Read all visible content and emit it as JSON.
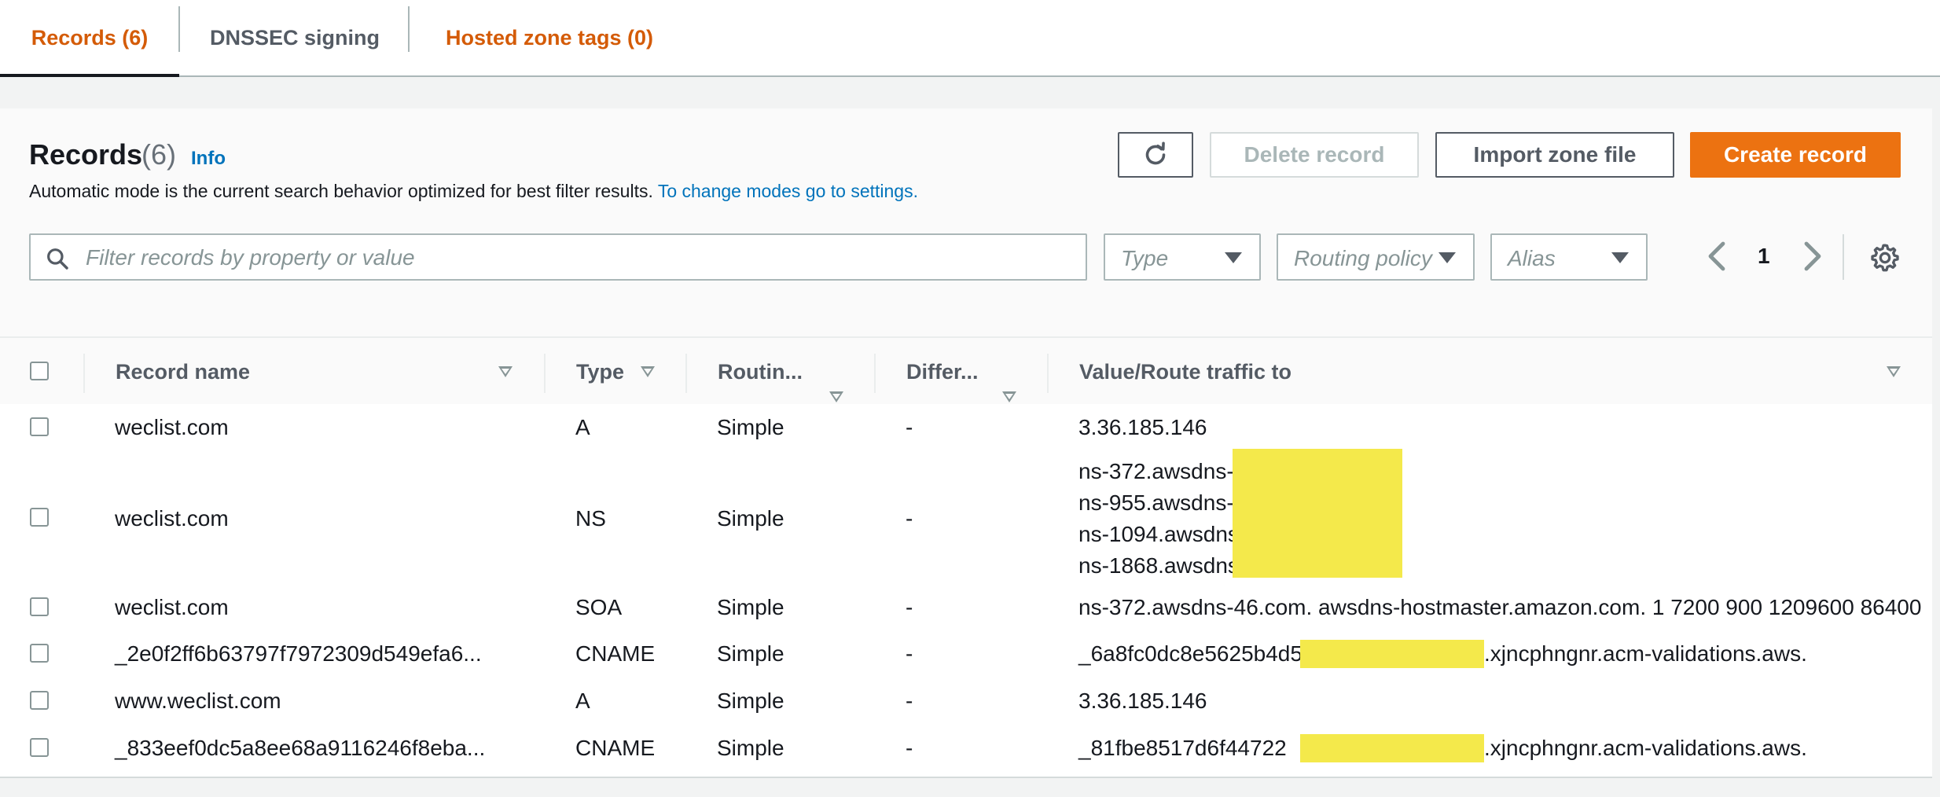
{
  "tabs": [
    {
      "label": "Records (6)",
      "active": true
    },
    {
      "label": "DNSSEC signing",
      "active": false
    },
    {
      "label": "Hosted zone tags (0)",
      "active": false
    }
  ],
  "header": {
    "title": "Records",
    "count": "(6)",
    "info": "Info",
    "description": "Automatic mode is the current search behavior optimized for best filter results. ",
    "description_link": "To change modes go to settings."
  },
  "actions": {
    "refresh": "refresh-icon",
    "delete": "Delete record",
    "import": "Import zone file",
    "create": "Create record"
  },
  "filters": {
    "search_placeholder": "Filter records by property or value",
    "search_value": "",
    "type": "Type",
    "routing_policy": "Routing policy",
    "alias": "Alias"
  },
  "pagination": {
    "current_page": "1"
  },
  "columns": [
    "Record name",
    "Type",
    "Routin...",
    "Differ...",
    "Value/Route traffic to"
  ],
  "rows": [
    {
      "name": "weclist.com",
      "type": "A",
      "routing": "Simple",
      "differ": "-",
      "values": [
        "3.36.185.146"
      ]
    },
    {
      "name": "weclist.com",
      "type": "NS",
      "routing": "Simple",
      "differ": "-",
      "values": [
        "ns-372.awsdns-",
        "ns-955.awsdns-",
        "ns-1094.awsdns",
        "ns-1868.awsdns"
      ]
    },
    {
      "name": "weclist.com",
      "type": "SOA",
      "routing": "Simple",
      "differ": "-",
      "values": [
        "ns-372.awsdns-46.com. awsdns-hostmaster.amazon.com. 1 7200 900 1209600 86400"
      ]
    },
    {
      "name": "_2e0f2ff6b63797f7972309d549efa6...",
      "type": "CNAME",
      "routing": "Simple",
      "differ": "-",
      "values": [
        "_6a8fc0dc8e5625b4d5"
      ],
      "suffix": ".xjncphngnr.acm-validations.aws."
    },
    {
      "name": "www.weclist.com",
      "type": "A",
      "routing": "Simple",
      "differ": "-",
      "values": [
        "3.36.185.146"
      ]
    },
    {
      "name": "_833eef0dc5a8ee68a9116246f8eba...",
      "type": "CNAME",
      "routing": "Simple",
      "differ": "-",
      "values": [
        "_81fbe8517d6f44722"
      ],
      "suffix": ".xjncphngnr.acm-validations.aws."
    }
  ],
  "colors": {
    "accent": "#ec7211",
    "tab_active": "#d45b07",
    "link": "#0073bb",
    "redaction": "#f4e94b"
  }
}
